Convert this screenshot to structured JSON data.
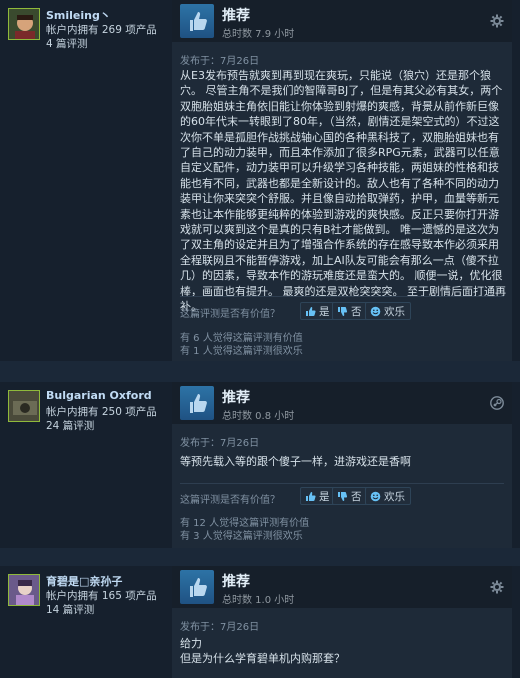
{
  "reviews": [
    {
      "persona": "Smileing丶",
      "owned": "帐户内拥有 269 项产品",
      "review_count": "4 篇评测",
      "recommendation": "推荐",
      "hours": "总时数 7.9 小时",
      "posted": "发布于：7月26日",
      "body": "从E3发布预告就爽到再到现在爽玩，只能说（狼穴）还是那个狼穴。  尽管主角不是我们的智障哥BJ了，但是有其父必有其女，两个双胞胎姐妹主角依旧能让你体验到射爆的爽感，背景从前作新巨像的60年代末一转眼到了80年，（当然，剧情还是架空式的）不过这次你不单是孤胆作战挑战轴心国的各种黑科技了，双胞胎姐妹也有了自己的动力装甲，而且本作添加了很多RPG元素，武器可以任意自定义配件，动力装甲可以升级学习各种技能，两姐妹的性格和技能也有不同，武器也都是全新设计的。敌人也有了各种不同的动力装甲让你来突突个舒服。并且像自动拾取弹药，护甲，血量等新元素也让本作能够更纯粹的体验到游戏的爽快感。反正只要你打开游戏就可以爽到这个是真的只有B社才能做到。 唯一遗憾的是这次为了双主角的设定并且为了增强合作系统的存在感导致本作必须采用全程联网且不能暂停游戏，加上AI队友可能会有那么一点（傻不拉几）的因素，导致本作的游玩难度还是蛮大的。 顺便一说，优化很棒，画面也有提升。 最爽的还是双枪突突突。  至于剧情后面打通再补。",
      "helpful_question": "这篇评测是否有价值？",
      "yes_label": "是",
      "no_label": "否",
      "funny_label": "欢乐",
      "helpful_count": "有 6 人觉得这篇评测有价值",
      "funny_count": "有 1 人觉得这篇评测很欢乐",
      "corner_icon": "gear-icon"
    },
    {
      "persona": "Bulgarian Oxford",
      "owned": "帐户内拥有 250 项产品",
      "review_count": "24 篇评测",
      "recommendation": "推荐",
      "hours": "总时数 0.8 小时",
      "posted": "发布于：7月26日",
      "body": "等预先载入等的跟个傻子一样，进游戏还是香啊",
      "helpful_question": "这篇评测是否有价值？",
      "yes_label": "是",
      "no_label": "否",
      "funny_label": "欢乐",
      "helpful_count": "有 12 人觉得这篇评测有价值",
      "funny_count": "有 3 人觉得这篇评测很欢乐",
      "corner_icon": "steam-icon"
    },
    {
      "persona": "育碧是□亲孙子",
      "owned": "帐户内拥有 165 项产品",
      "review_count": "14 篇评测",
      "recommendation": "推荐",
      "hours": "总时数 1.0 小时",
      "posted": "发布于：7月26日",
      "body": "给力\n但是为什么学育碧单机内购那套？",
      "corner_icon": "gear-icon"
    }
  ],
  "colors": {
    "background": "#1b2838",
    "card": "#16202d",
    "accent": "#67c1f5",
    "avatar_border": "#8fb93b"
  }
}
